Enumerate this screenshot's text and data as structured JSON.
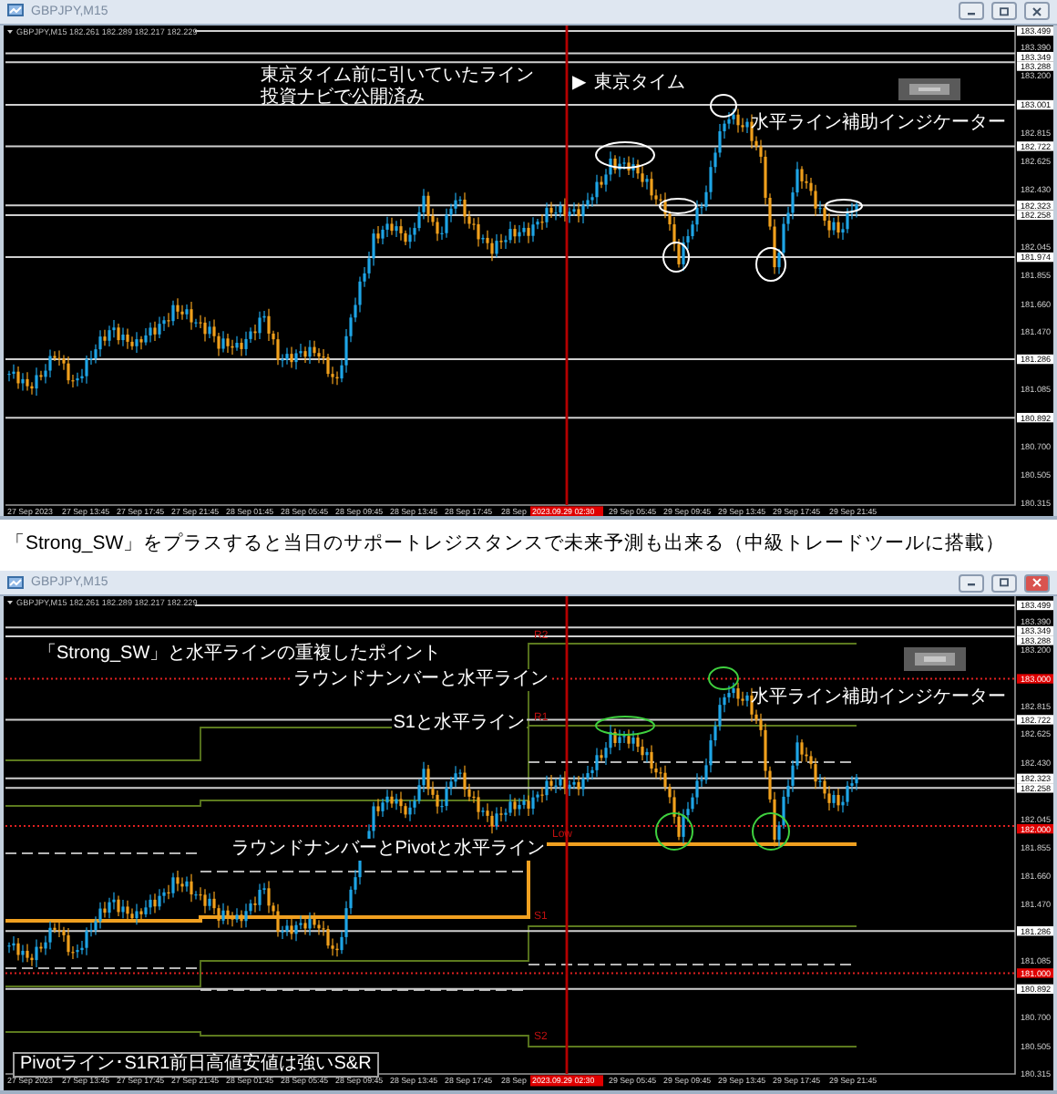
{
  "windows": [
    {
      "title": "GBPJPY,M15",
      "symbol_line": "GBPJPY,M15  182.261 182.289 182.217 182.229",
      "annotations": [
        {
          "kind": "note",
          "lines": [
            "東京タイム前に引いていたライン",
            "投資ナビで公開済み"
          ]
        },
        {
          "kind": "marker",
          "icon": "▶",
          "text": "東京タイム"
        },
        {
          "kind": "note",
          "lines": [
            "水平ライン補助インジケーター"
          ]
        }
      ],
      "price_axis": [
        {
          "label": "183.499",
          "kind": "line"
        },
        {
          "label": "183.390",
          "kind": "plain"
        },
        {
          "label": "183.349",
          "kind": "line"
        },
        {
          "label": "183.288",
          "kind": "line"
        },
        {
          "label": "183.200",
          "kind": "plain"
        },
        {
          "label": "183.001",
          "kind": "line"
        },
        {
          "label": "182.815",
          "kind": "plain"
        },
        {
          "label": "182.722",
          "kind": "line"
        },
        {
          "label": "182.625",
          "kind": "plain"
        },
        {
          "label": "182.430",
          "kind": "plain"
        },
        {
          "label": "182.323",
          "kind": "line"
        },
        {
          "label": "182.258",
          "kind": "line"
        },
        {
          "label": "182.045",
          "kind": "plain"
        },
        {
          "label": "181.974",
          "kind": "line"
        },
        {
          "label": "181.855",
          "kind": "plain"
        },
        {
          "label": "181.660",
          "kind": "plain"
        },
        {
          "label": "181.470",
          "kind": "plain"
        },
        {
          "label": "181.286",
          "kind": "line"
        },
        {
          "label": "181.085",
          "kind": "plain"
        },
        {
          "label": "180.892",
          "kind": "line"
        },
        {
          "label": "180.700",
          "kind": "plain"
        },
        {
          "label": "180.505",
          "kind": "plain"
        },
        {
          "label": "180.315",
          "kind": "plain"
        }
      ],
      "time_axis": [
        {
          "label": "27 Sep 2023",
          "kind": "plain"
        },
        {
          "label": "27 Sep 13:45",
          "kind": "plain"
        },
        {
          "label": "27 Sep 17:45",
          "kind": "plain"
        },
        {
          "label": "27 Sep 21:45",
          "kind": "plain"
        },
        {
          "label": "28 Sep 01:45",
          "kind": "plain"
        },
        {
          "label": "28 Sep 05:45",
          "kind": "plain"
        },
        {
          "label": "28 Sep 09:45",
          "kind": "plain"
        },
        {
          "label": "28 Sep 13:45",
          "kind": "plain"
        },
        {
          "label": "28 Sep 17:45",
          "kind": "plain"
        },
        {
          "label": "28 Sep",
          "kind": "plain"
        },
        {
          "label": "2023.09.29 02:30",
          "kind": "cursor"
        },
        {
          "label": "29 Sep 05:45",
          "kind": "plain"
        },
        {
          "label": "29 Sep 09:45",
          "kind": "plain"
        },
        {
          "label": "29 Sep 13:45",
          "kind": "plain"
        },
        {
          "label": "29 Sep 17:45",
          "kind": "plain"
        },
        {
          "label": "29 Sep 21:45",
          "kind": "plain"
        }
      ]
    },
    {
      "title": "GBPJPY,M15",
      "symbol_line": "GBPJPY,M15  182.261 182.289 182.217 182.229",
      "annotations": [
        {
          "kind": "note",
          "lines": [
            "「Strong_SW」と水平ラインの重複したポイント"
          ]
        },
        {
          "kind": "callout",
          "lines": [
            "ラウンドナンバーと水平ライン"
          ]
        },
        {
          "kind": "callout",
          "lines": [
            "S1と水平ライン"
          ]
        },
        {
          "kind": "callout",
          "lines": [
            "ラウンドナンバーとPivotと水平ライン"
          ]
        },
        {
          "kind": "note",
          "lines": [
            "水平ライン補助インジケーター"
          ]
        },
        {
          "kind": "pivot",
          "lines": [
            "R2"
          ]
        },
        {
          "kind": "pivot",
          "lines": [
            "R1"
          ]
        },
        {
          "kind": "pivot",
          "lines": [
            "Low"
          ]
        },
        {
          "kind": "pivot",
          "lines": [
            "S1"
          ]
        },
        {
          "kind": "pivot",
          "lines": [
            "S2"
          ]
        },
        {
          "kind": "legend",
          "lines": [
            "Pivotライン･S1R1前日高値安値は強いS&R"
          ]
        }
      ],
      "price_axis": [
        {
          "label": "183.499",
          "kind": "line"
        },
        {
          "label": "183.390",
          "kind": "plain"
        },
        {
          "label": "183.349",
          "kind": "line"
        },
        {
          "label": "183.288",
          "kind": "line"
        },
        {
          "label": "183.200",
          "kind": "plain"
        },
        {
          "label": "183.000",
          "kind": "round"
        },
        {
          "label": "182.815",
          "kind": "plain"
        },
        {
          "label": "182.722",
          "kind": "line"
        },
        {
          "label": "182.625",
          "kind": "plain"
        },
        {
          "label": "182.430",
          "kind": "plain"
        },
        {
          "label": "182.323",
          "kind": "line"
        },
        {
          "label": "182.258",
          "kind": "line"
        },
        {
          "label": "182.045",
          "kind": "plain"
        },
        {
          "label": "182.000",
          "kind": "round"
        },
        {
          "label": "181.855",
          "kind": "plain"
        },
        {
          "label": "181.660",
          "kind": "plain"
        },
        {
          "label": "181.470",
          "kind": "plain"
        },
        {
          "label": "181.286",
          "kind": "line"
        },
        {
          "label": "181.085",
          "kind": "plain"
        },
        {
          "label": "181.000",
          "kind": "round"
        },
        {
          "label": "180.892",
          "kind": "line"
        },
        {
          "label": "180.700",
          "kind": "plain"
        },
        {
          "label": "180.505",
          "kind": "plain"
        },
        {
          "label": "180.315",
          "kind": "plain"
        }
      ],
      "time_axis": [
        {
          "label": "27 Sep 2023",
          "kind": "plain"
        },
        {
          "label": "27 Sep 13:45",
          "kind": "plain"
        },
        {
          "label": "27 Sep 17:45",
          "kind": "plain"
        },
        {
          "label": "27 Sep 21:45",
          "kind": "plain"
        },
        {
          "label": "28 Sep 01:45",
          "kind": "plain"
        },
        {
          "label": "28 Sep 05:45",
          "kind": "plain"
        },
        {
          "label": "28 Sep 09:45",
          "kind": "plain"
        },
        {
          "label": "28 Sep 13:45",
          "kind": "plain"
        },
        {
          "label": "28 Sep 17:45",
          "kind": "plain"
        },
        {
          "label": "28 Sep",
          "kind": "plain"
        },
        {
          "label": "2023.09.29 02:30",
          "kind": "cursor"
        },
        {
          "label": "29 Sep 05:45",
          "kind": "plain"
        },
        {
          "label": "29 Sep 09:45",
          "kind": "plain"
        },
        {
          "label": "29 Sep 13:45",
          "kind": "plain"
        },
        {
          "label": "29 Sep 17:45",
          "kind": "plain"
        },
        {
          "label": "29 Sep 21:45",
          "kind": "plain"
        }
      ]
    }
  ],
  "caption": "「Strong_SW」をプラスすると当日のサポートレジスタンスで未来予測も出来る（中級トレードツールに搭載）"
}
